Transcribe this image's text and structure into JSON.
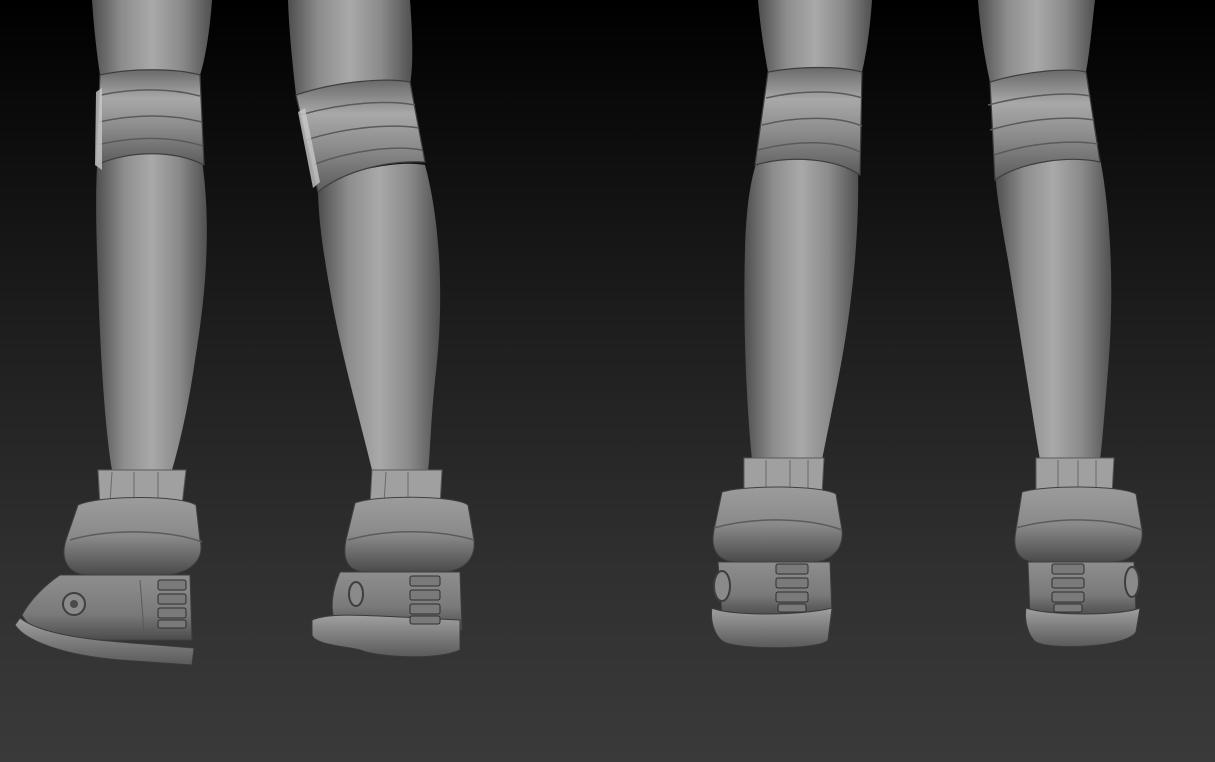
{
  "viewport": {
    "background_top": "#000000",
    "background_bottom": "#3a3a3a",
    "clay_base": "#8a8a8a",
    "clay_light": "#b4b4b4",
    "clay_dark": "#4e4e4e"
  },
  "scene": {
    "figure_count": 2,
    "views": [
      "rear-three-quarter",
      "rear"
    ]
  }
}
